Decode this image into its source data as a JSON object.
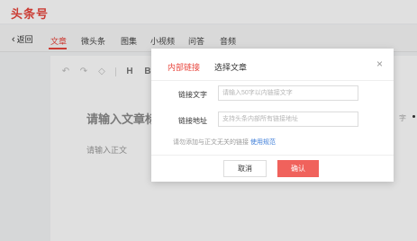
{
  "app": {
    "logo": "头条号"
  },
  "nav": {
    "back_label": "返回",
    "tabs": [
      {
        "label": "文章",
        "active": true
      },
      {
        "label": "微头条",
        "active": false
      },
      {
        "label": "图集",
        "active": false
      },
      {
        "label": "小视频",
        "active": false
      },
      {
        "label": "问答",
        "active": false
      },
      {
        "label": "音频",
        "active": false
      }
    ]
  },
  "editor": {
    "title_placeholder": "请输入文章标",
    "body_placeholder": "请输入正文",
    "side_text": "字"
  },
  "modal": {
    "tabs": [
      {
        "label": "内部链接",
        "active": true
      },
      {
        "label": "选择文章",
        "active": false
      }
    ],
    "close_icon": "×",
    "fields": [
      {
        "label": "链接文字",
        "placeholder": "请输入50字以内链接文字"
      },
      {
        "label": "链接地址",
        "placeholder": "支持头条内部所有链接地址"
      }
    ],
    "hint_text": "请勿添加与正文无关的链接",
    "hint_link": "使用规范",
    "cancel_label": "取消",
    "ok_label": "确认"
  },
  "colors": {
    "accent": "#e8453c",
    "confirm": "#f0625c",
    "link": "#3d7dd8"
  }
}
